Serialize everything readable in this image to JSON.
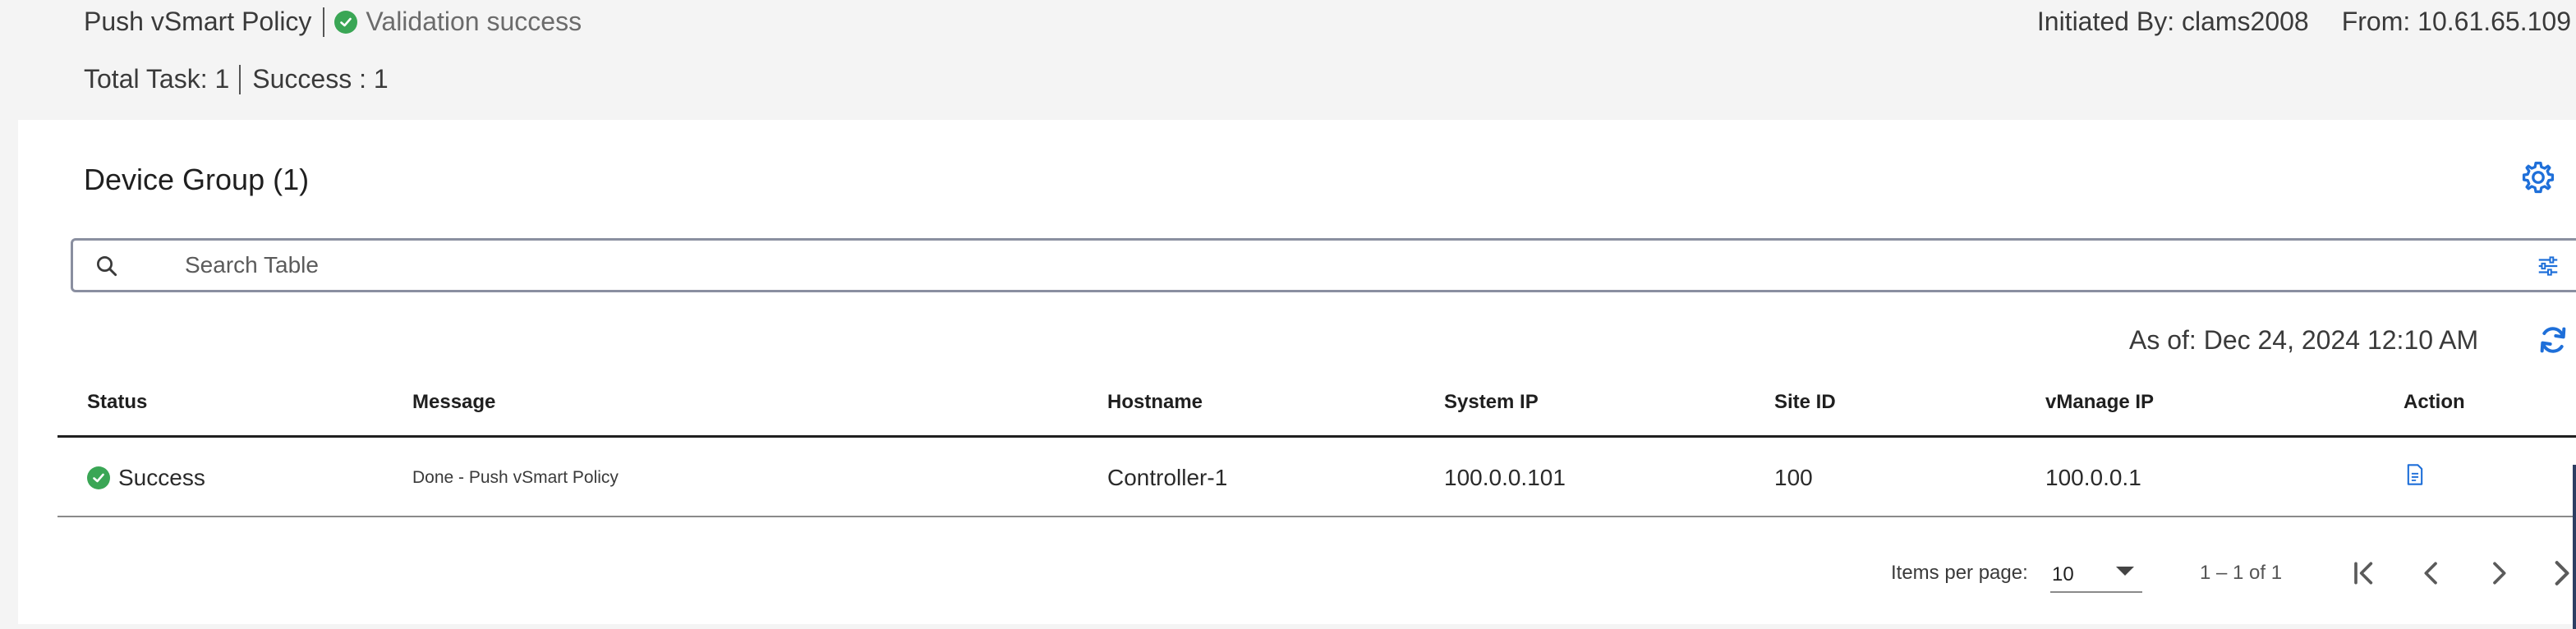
{
  "header": {
    "task_name": "Push vSmart Policy",
    "validation_status": "Validation success",
    "initiated_by": "Initiated By: clams2008",
    "from": "From: 10.61.65.109",
    "total_task": "Total Task: 1",
    "success": "Success : 1"
  },
  "group": {
    "title": "Device Group (1)",
    "settings_icon": "gear-icon"
  },
  "search": {
    "placeholder": "Search Table",
    "value": "",
    "icon": "search-icon",
    "filter_icon": "filter-icon"
  },
  "as_of": "As of: Dec 24, 2024 12:10 AM",
  "table": {
    "columns": [
      "Status",
      "Message",
      "Hostname",
      "System IP",
      "Site ID",
      "vManage IP",
      "Action"
    ],
    "rows": [
      {
        "status": "Success",
        "message": "Done - Push vSmart Policy",
        "hostname": "Controller-1",
        "system_ip": "100.0.0.101",
        "site_id": "100",
        "vmanage_ip": "100.0.0.1",
        "action_icon": "document-icon"
      }
    ]
  },
  "pagination": {
    "items_per_page_label": "Items per page:",
    "items_per_page": "10",
    "range": "1 – 1 of 1"
  },
  "colors": {
    "accent": "#1e6fd9",
    "success": "#3aa655",
    "table_header_rule": "#1f1f1f"
  }
}
